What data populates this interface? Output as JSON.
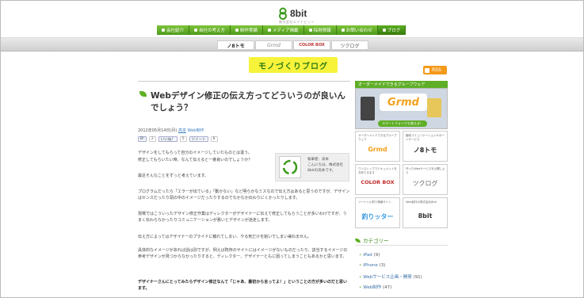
{
  "header": {
    "logo_text": "8bit",
    "logo_sub": "株式会社エイトビット",
    "nav": [
      {
        "label": "会社紹介"
      },
      {
        "label": "自社の考え方"
      },
      {
        "label": "制作実績"
      },
      {
        "label": "メディア掲載"
      },
      {
        "label": "採用情報"
      },
      {
        "label": "お問い合わせ"
      },
      {
        "label": "ブログ"
      }
    ]
  },
  "subnav": {
    "items": [
      {
        "label": "ノ8トモ"
      },
      {
        "label": "Grmd"
      },
      {
        "label": "COLOR BOX"
      },
      {
        "label": "ツクログ"
      }
    ]
  },
  "site_banner": "モノづくりブログ",
  "rss_label": "RSS",
  "post": {
    "title": "Webデザイン修正の伝え方ってどういうのが良いんでしょう？",
    "date": "2012年05月14日(月)",
    "author": "高本",
    "category": "Web制作",
    "social": [
      {
        "label": "B!",
        "count": "2"
      },
      {
        "label": "いいね！",
        "count": "5"
      },
      {
        "label": "ツイート",
        "count": "8"
      }
    ],
    "paragraphs": [
      "デザインをしてもらって自分のイメージしていたものとは違う。",
      "修正してもらいたい時、なんて伝えると一番良いのでしょうか？",
      "最近そんなことをずっと考えています。",
      "プログラムだったら「エラーが出ている」「動かない」など明らかなミスなので伝え方はあると思うのですが、デザインはセンスだったり頭の中のイメージだったりするのでなかなか伝わりにくかったりします。",
      "現場ではこういったデザイン修正作業はディレクターがデザイナーに伝えて修正してもらうことが多いわけですが、うまく伝わらなかったりコミュニケーションが悪いとデザインが迷走します。",
      "伝え方によってはデザイナーのプライドに触れてしまい、やる気だけを削いでしまい兼ねません。",
      "具体的なイメージがあれば話は別ですが、例えば既存のサイトにはイメージがないものだったり、該当するイメージの参考デザインが見つからなかったりすると、ディレクター、デザイナーともに困ってしまうこともあるかと思います。",
      "デザイナーさんにとってみたらデザイン修正なんて「じゃあ、最初から言ってよ！」ということの方が多いのだと思います。"
    ],
    "author_box": {
      "name_line": "執筆者：高本",
      "greeting": "こんにちは、株式会社",
      "greeting2": "8bitの高本です。"
    }
  },
  "sidebar": {
    "feature_head": "オーダーメイドできるグループウェア",
    "feature_brand": "Grmd",
    "feature_cta": "スマートフォンでも使える！",
    "cards": [
      {
        "caption": "オーダーメイドできるグループウェア",
        "brand": "Grmd",
        "color": "#f3a11c"
      },
      {
        "caption": "趣味コミュニケーションサポートサービス",
        "brand": "ノ8トモ",
        "color": "#222222"
      },
      {
        "caption": "ワンストップでドキュメントを共有できます",
        "brand": "COLOR BOX",
        "color": "#c22e2e"
      },
      {
        "caption": "作ったWebサービスを公開しよう",
        "brand": "ツクログ",
        "color": "#666666"
      },
      {
        "caption": "ソーシャル釣り情報サイト",
        "brand": "釣りッター",
        "color": "#3a9adf"
      },
      {
        "caption": "Web制作の株式会社8bit",
        "brand": "8bit",
        "color": "#333333"
      }
    ],
    "category_head": "カテゴリー",
    "categories": [
      {
        "label": "iPad",
        "count": "(9)"
      },
      {
        "label": "iPhone",
        "count": "(3)"
      },
      {
        "label": "Webサービス企画・開発",
        "count": "(91)"
      },
      {
        "label": "Web制作",
        "count": "(47)"
      }
    ]
  }
}
